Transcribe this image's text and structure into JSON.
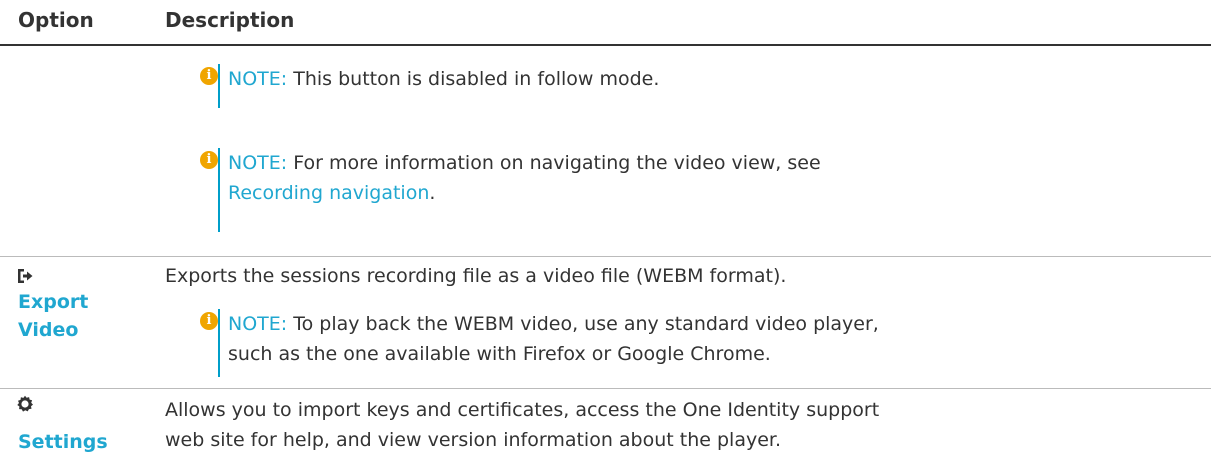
{
  "header": {
    "option": "Option",
    "description": "Description"
  },
  "rows": [
    {
      "notes": [
        {
          "label": "NOTE:",
          "text": " This button is disabled in follow mode."
        },
        {
          "label": "NOTE:",
          "text": " For more information on navigating the video view, see",
          "link": "Recording navigation",
          "after": "."
        }
      ]
    },
    {
      "icon": "export-icon",
      "label_line1": "Export",
      "label_line2": "Video",
      "description": "Exports the sessions recording file as a video file (WEBM format).",
      "notes": [
        {
          "label": "NOTE:",
          "line1": " To play back the WEBM video, use any standard video player,",
          "line2": "such as the one available with Firefox or Google Chrome."
        }
      ]
    },
    {
      "icon": "gear-icon",
      "label": "Settings",
      "desc_line1": "Allows you to import keys and certificates, access the One Identity support",
      "desc_line2": "web site for help, and view version information about the player."
    }
  ],
  "colors": {
    "accent": "#20a7d0",
    "note_bar": "#009ec9",
    "info_icon": "#f0a500",
    "text": "#333333"
  }
}
